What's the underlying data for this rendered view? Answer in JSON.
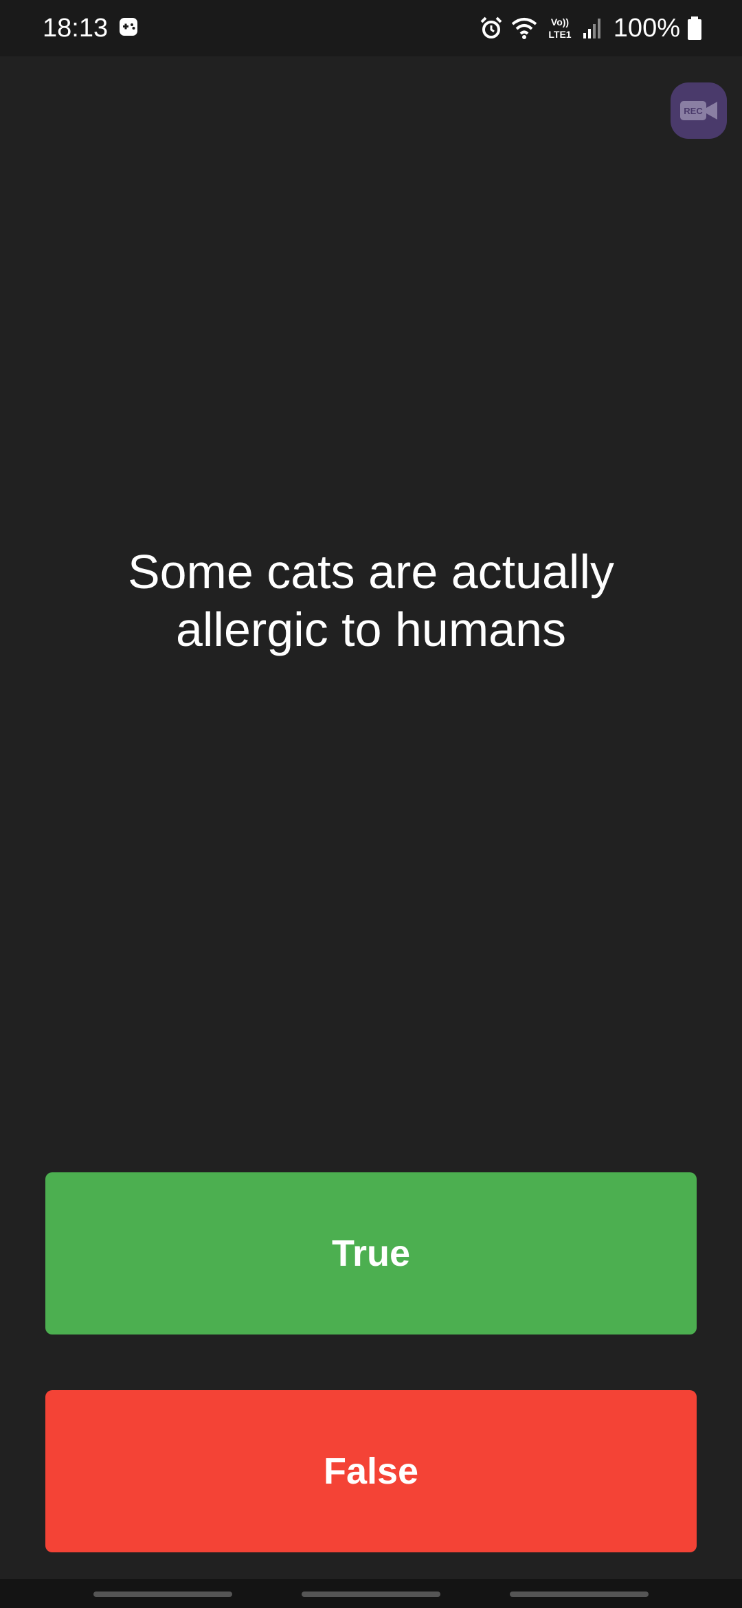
{
  "status_bar": {
    "time": "18:13",
    "network_label": "Vo)) LTE1",
    "battery": "100%",
    "icons": [
      "game-controller-icon",
      "alarm-icon",
      "wifi-icon",
      "volte-icon",
      "signal-icon",
      "battery-icon"
    ]
  },
  "overlay": {
    "rec_label": "REC",
    "icon": "video-camera-icon",
    "color": "#4a3a6b"
  },
  "question": {
    "text": "Some cats are actually allergic to humans"
  },
  "answers": {
    "true_label": "True",
    "false_label": "False",
    "true_color": "#4caf50",
    "false_color": "#f44336"
  },
  "colors": {
    "background": "#212121",
    "status_bar": "#1a1a1a"
  }
}
